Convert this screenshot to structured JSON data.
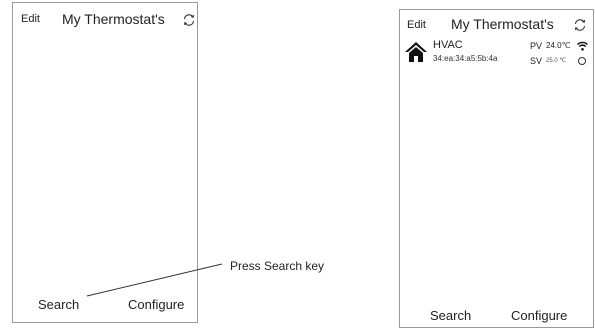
{
  "left_screen": {
    "edit_label": "Edit",
    "title": "My Thermostat's",
    "refresh_icon": "refresh-icon",
    "search_label": "Search",
    "configure_label": "Configure"
  },
  "right_screen": {
    "edit_label": "Edit",
    "title": "My Thermostat's",
    "refresh_icon": "refresh-icon",
    "device": {
      "name": "HVAC",
      "mac": "34:ea:34:a5:5b:4a",
      "pv_label": "PV",
      "pv_value": "24.0℃",
      "sv_label": "SV",
      "sv_value": "25.0 ℃",
      "icon": "house-icon",
      "signal_icon": "wifi-icon"
    },
    "search_label": "Search",
    "configure_label": "Configure"
  },
  "callout": {
    "text": "Press Search key"
  },
  "colors": {
    "border": "#9a9a9a",
    "text": "#222222",
    "background": "#ffffff"
  }
}
